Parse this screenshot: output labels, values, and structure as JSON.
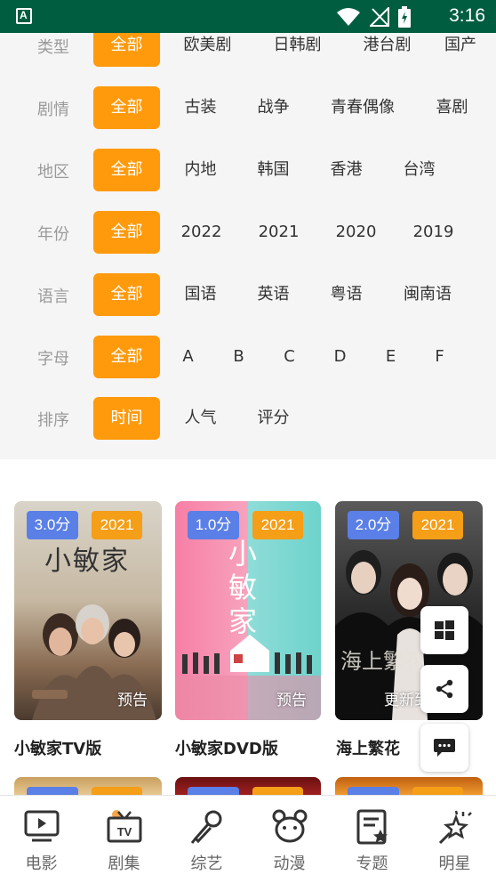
{
  "status_bar": {
    "time": "3:16"
  },
  "filters": [
    {
      "label": "类型",
      "options": [
        "全部",
        "欧美剧",
        "日韩剧",
        "港台剧",
        "国产"
      ],
      "selected": "全部"
    },
    {
      "label": "剧情",
      "options": [
        "全部",
        "古装",
        "战争",
        "青春偶像",
        "喜剧"
      ],
      "selected": "全部"
    },
    {
      "label": "地区",
      "options": [
        "全部",
        "内地",
        "韩国",
        "香港",
        "台湾"
      ],
      "selected": "全部"
    },
    {
      "label": "年份",
      "options": [
        "全部",
        "2022",
        "2021",
        "2020",
        "2019"
      ],
      "selected": "全部"
    },
    {
      "label": "语言",
      "options": [
        "全部",
        "国语",
        "英语",
        "粤语",
        "闽南语"
      ],
      "selected": "全部"
    },
    {
      "label": "字母",
      "options": [
        "全部",
        "A",
        "B",
        "C",
        "D",
        "E",
        "F"
      ],
      "selected": "全部"
    },
    {
      "label": "排序",
      "options": [
        "时间",
        "人气",
        "评分"
      ],
      "selected": "时间"
    }
  ],
  "cards": [
    {
      "score": "3.0分",
      "year": "2021",
      "tag": "预告",
      "title": "小敏家TV版",
      "poster_title": "小敏家"
    },
    {
      "score": "1.0分",
      "year": "2021",
      "tag": "预告",
      "title": "小敏家DVD版",
      "poster_title": "小敏家"
    },
    {
      "score": "2.0分",
      "year": "2021",
      "tag": "更新到",
      "title": "海上繁花",
      "poster_title": "海上繁花"
    }
  ],
  "floating_buttons": [
    "windows-icon",
    "share-icon",
    "chat-icon"
  ],
  "bottom_nav": [
    {
      "label": "电影",
      "icon": "movie-screen-icon"
    },
    {
      "label": "剧集",
      "icon": "tv-icon"
    },
    {
      "label": "综艺",
      "icon": "microphone-icon"
    },
    {
      "label": "动漫",
      "icon": "cartoon-bear-icon"
    },
    {
      "label": "专题",
      "icon": "topic-star-icon"
    },
    {
      "label": "明星",
      "icon": "star-sparkle-icon"
    }
  ],
  "colors": {
    "status_bar": "#005d40",
    "accent": "#ff9a0c",
    "score_badge": "#5a7fe6",
    "year_badge": "#f59e17"
  }
}
